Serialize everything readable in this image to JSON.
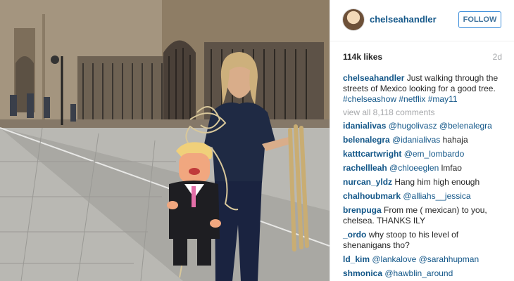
{
  "post": {
    "username": "chelseahandler",
    "follow_label": "FOLLOW",
    "likes": "114k likes",
    "age": "2d",
    "caption": {
      "username": "chelseahandler",
      "text": "Just walking through the streets of Mexico looking for a good tree.",
      "hashtags": "#chelseashow #netflix #may11"
    },
    "view_all": "view all 8,118 comments"
  },
  "comments": [
    {
      "user": "idanialivas",
      "mention": "@hugolivasz @belenalegra",
      "text": ""
    },
    {
      "user": "belenalegra",
      "mention": "@idanialivas",
      "text": "hahaja"
    },
    {
      "user": "katttcartwright",
      "mention": "@em_lombardo",
      "text": ""
    },
    {
      "user": "rachellleah",
      "mention": "@chloeeglen",
      "text": "lmfao"
    },
    {
      "user": "nurcan_yldz",
      "mention": "",
      "text": "Hang him high enough"
    },
    {
      "user": "chalhoubmark",
      "mention": "@alliahs__jessica",
      "text": ""
    },
    {
      "user": "brenpuga",
      "mention": "",
      "text": "From me ( mexican) to you, chelsea. THANKS ILY"
    },
    {
      "user": "_ordo",
      "mention": "",
      "text": "why stoop to his level of shenanigans tho?"
    },
    {
      "user": "ld_kim",
      "mention": "@lankalove @sarahhupman",
      "text": ""
    },
    {
      "user": "shmonica",
      "mention": "@hawblin_around",
      "text": ""
    }
  ],
  "colors": {
    "username_blue": "#125688",
    "follow_border": "#4090db",
    "muted": "#a5a7aa"
  },
  "icons": {
    "avatar": "profile-photo"
  }
}
